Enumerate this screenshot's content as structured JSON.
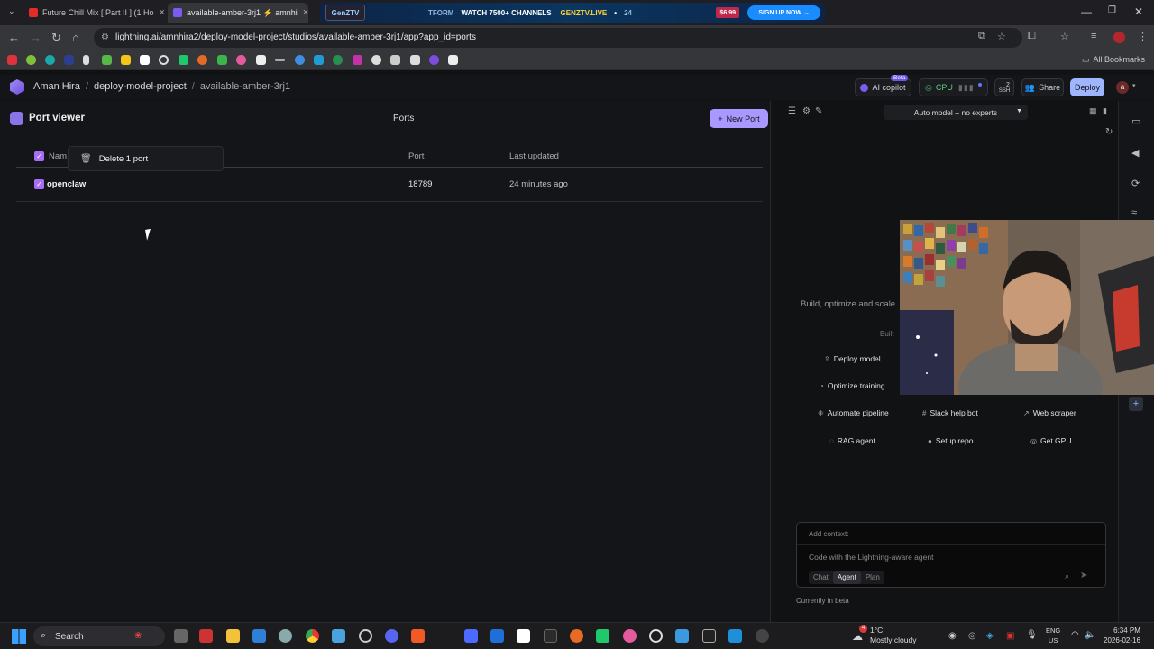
{
  "browser": {
    "tabs": [
      {
        "title": "Future Chill Mix [ Part II ] (1 Ho",
        "close": "×"
      },
      {
        "title": "available-amber-3rj1 ⚡ amnhi",
        "close": "×"
      },
      {
        "title": "",
        "close": "×"
      }
    ],
    "ad": {
      "brand": "GenZTV",
      "left_text": "TFORM",
      "text": "WATCH 7500+ CHANNELS",
      "url": "GENZTV.LIVE",
      "tail": "24",
      "price": "$6.99",
      "cta": "SIGN UP NOW →"
    },
    "url": "lightning.ai/amnhira2/deploy-model-project/studios/available-amber-3rj1/app?app_id=ports",
    "all_bookmarks": "All Bookmarks"
  },
  "header": {
    "crumbs": [
      "Aman Hira",
      "deploy-model-project",
      "available-amber-3rj1"
    ],
    "ai_copilot": "AI copilot",
    "beta_badge": "Beta",
    "cpu": "CPU",
    "ssh_count": "2",
    "ssh": "SSH",
    "share": "Share",
    "deploy": "Deploy",
    "avatar": "a"
  },
  "port_viewer": {
    "title": "Port viewer",
    "center_title": "Ports",
    "new_port": "New Port",
    "columns": {
      "name": "Nam",
      "port": "Port",
      "updated": "Last updated"
    },
    "context_menu": "Delete 1 port",
    "rows": [
      {
        "name": "openclaw",
        "port": "18789",
        "updated": "24 minutes ago"
      }
    ]
  },
  "assistant": {
    "model_selector": "Auto model + no experts",
    "tagline": "Build, optimize and scale",
    "built": "Built",
    "actions": [
      "Deploy model",
      "Optimize training",
      "Automate pipeline",
      "Slack help bot",
      "Web scraper",
      "RAG agent",
      "Setup repo",
      "Get GPU"
    ],
    "composer": {
      "context": "Add context:",
      "placeholder": "Code with the Lightning-aware agent",
      "modes": [
        "Chat",
        "Agent",
        "Plan"
      ]
    },
    "footnote": "Currently in beta"
  },
  "taskbar": {
    "search": "Search",
    "weather_temp": "1°C",
    "weather_desc": "Mostly cloudy",
    "weather_badge": "4",
    "lang1": "ENG",
    "lang2": "US",
    "time": "6:34 PM",
    "date": "2026-02-16"
  }
}
